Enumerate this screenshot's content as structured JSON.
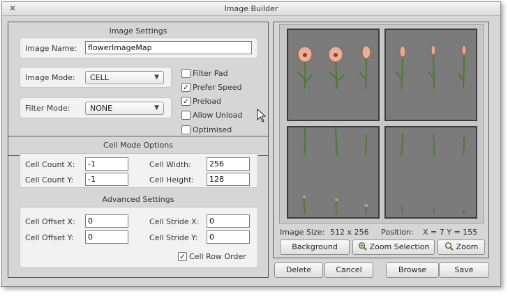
{
  "window": {
    "title": "Image Builder"
  },
  "image_settings": {
    "title": "Image Settings",
    "image_name_label": "Image Name:",
    "image_name_value": "flowerImageMap",
    "image_mode_label": "Image Mode:",
    "image_mode_value": "CELL",
    "filter_mode_label": "Filter Mode:",
    "filter_mode_value": "NONE",
    "checkboxes": [
      {
        "label": "Filter Pad",
        "checked": false
      },
      {
        "label": "Prefer Speed",
        "checked": true
      },
      {
        "label": "Preload",
        "checked": true
      },
      {
        "label": "Allow Unload",
        "checked": false
      },
      {
        "label": "Optimised",
        "checked": false
      }
    ]
  },
  "cell_mode": {
    "title": "Cell Mode Options",
    "count_x_label": "Cell Count X:",
    "count_x_value": "-1",
    "count_y_label": "Cell Count Y:",
    "count_y_value": "-1",
    "width_label": "Cell Width:",
    "width_value": "256",
    "height_label": "Cell Height:",
    "height_value": "128"
  },
  "advanced": {
    "title": "Advanced Settings",
    "offset_x_label": "Cell Offset X:",
    "offset_x_value": "0",
    "offset_y_label": "Cell Offset Y:",
    "offset_y_value": "0",
    "stride_x_label": "Cell Stride X:",
    "stride_x_value": "0",
    "stride_y_label": "Cell Stride Y:",
    "stride_y_value": "0",
    "row_order_label": "Cell Row Order",
    "row_order_checked": true
  },
  "preview": {
    "image_size_label": "Image Size:",
    "image_size_value": "512 x 256",
    "position_label": "Position:",
    "position_value": "X = 7  Y = 155",
    "background_button": "Background",
    "zoom_selection_button": "Zoom Selection",
    "zoom_button": "Zoom"
  },
  "footer": {
    "delete": "Delete",
    "cancel": "Cancel",
    "browse": "Browse",
    "save": "Save"
  },
  "icons": {
    "close": "close-icon",
    "zoom_selection": "magnifier-plus-icon",
    "zoom": "magnifier-icon",
    "cursor": "mouse-pointer-icon"
  }
}
